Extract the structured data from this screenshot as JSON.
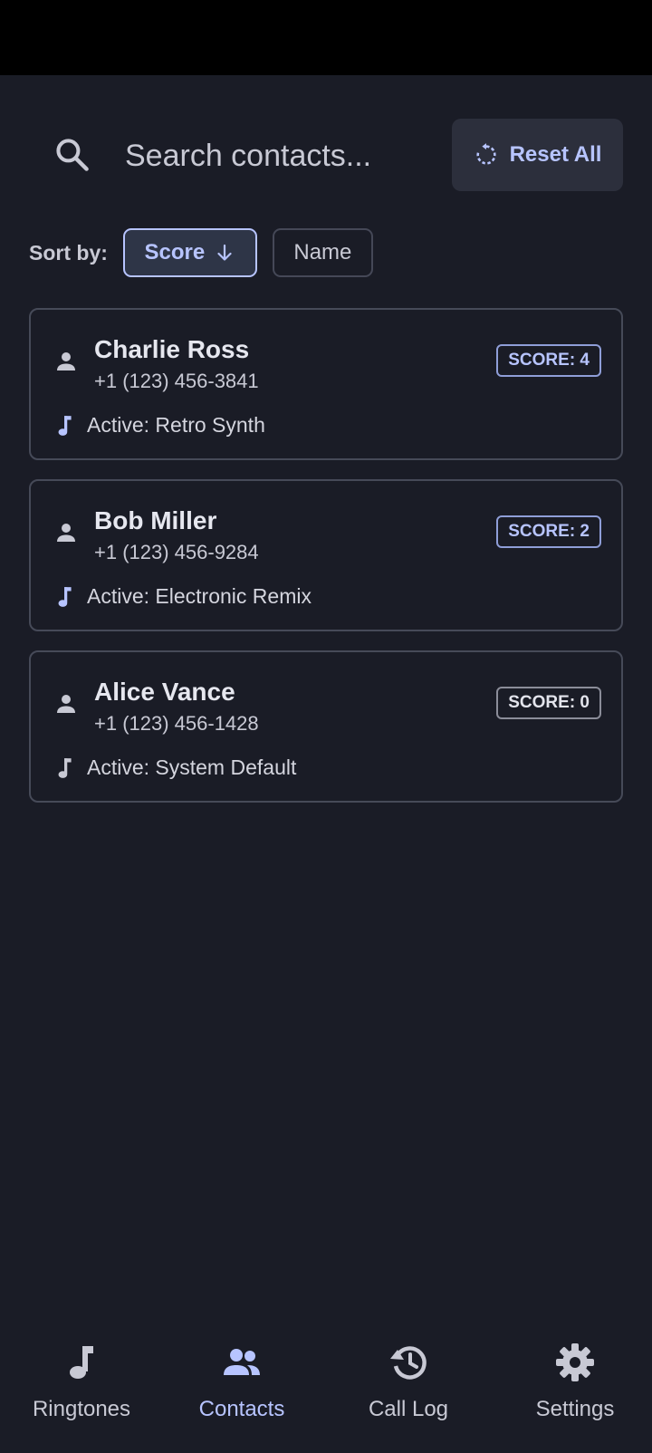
{
  "search": {
    "placeholder": "Search contacts..."
  },
  "reset_button": {
    "label": "Reset All"
  },
  "sort": {
    "label": "Sort by:",
    "options": [
      {
        "label": "Score",
        "selected": true
      },
      {
        "label": "Name",
        "selected": false
      }
    ]
  },
  "contacts": [
    {
      "name": "Charlie Ross",
      "phone": "+1 (123) 456-3841",
      "score": "SCORE: 4",
      "active": "Active: Retro Synth"
    },
    {
      "name": "Bob Miller",
      "phone": "+1 (123) 456-9284",
      "score": "SCORE: 2",
      "active": "Active: Electronic Remix"
    },
    {
      "name": "Alice Vance",
      "phone": "+1 (123) 456-1428",
      "score": "SCORE: 0",
      "active": "Active: System Default"
    }
  ],
  "nav": {
    "items": [
      {
        "label": "Ringtones",
        "icon": "music-note-icon"
      },
      {
        "label": "Contacts",
        "icon": "group-icon",
        "active": true
      },
      {
        "label": "Call Log",
        "icon": "history-icon"
      },
      {
        "label": "Settings",
        "icon": "gear-icon"
      }
    ]
  },
  "colors": {
    "background": "#1a1c26",
    "accent": "#b7c4ff",
    "card_border": "#464a58",
    "surface": "#2c2f3c"
  }
}
